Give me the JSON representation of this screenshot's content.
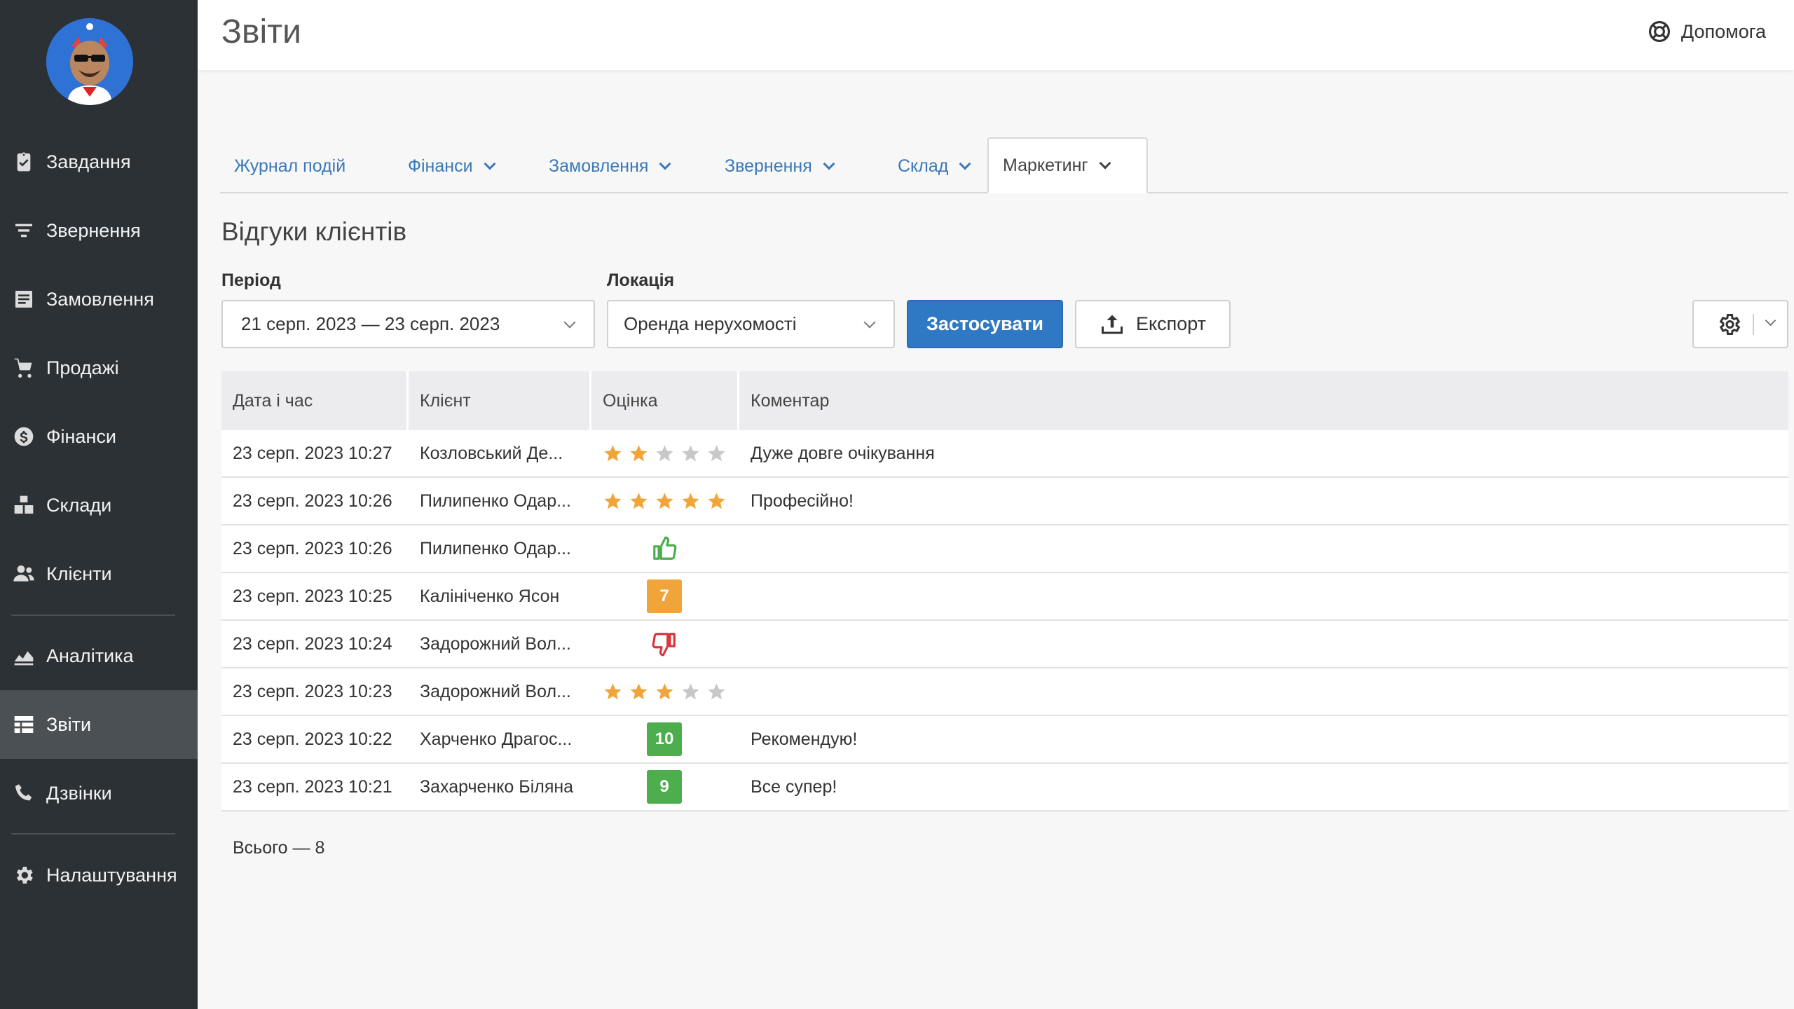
{
  "sidebar": {
    "items": [
      {
        "label": "Завдання",
        "icon": "clipboard-icon"
      },
      {
        "label": "Звернення",
        "icon": "filter-icon"
      },
      {
        "label": "Замовлення",
        "icon": "order-list-icon"
      },
      {
        "label": "Продажі",
        "icon": "cart-icon"
      },
      {
        "label": "Фінанси",
        "icon": "dollar-circle-icon"
      },
      {
        "label": "Склади",
        "icon": "boxes-icon"
      },
      {
        "label": "Клієнти",
        "icon": "users-icon"
      },
      {
        "label": "Аналітика",
        "icon": "area-chart-icon"
      },
      {
        "label": "Звіти",
        "icon": "table-icon",
        "active": true
      },
      {
        "label": "Дзвінки",
        "icon": "phone-icon"
      },
      {
        "label": "Налаштування",
        "icon": "gear-icon"
      }
    ]
  },
  "header": {
    "title": "Звіти",
    "help_label": "Допомога"
  },
  "tabs": [
    {
      "label": "Журнал подій",
      "dropdown": false
    },
    {
      "label": "Фінанси",
      "dropdown": true
    },
    {
      "label": "Замовлення",
      "dropdown": true
    },
    {
      "label": "Звернення",
      "dropdown": true
    },
    {
      "label": "Склад",
      "dropdown": true
    },
    {
      "label": "Маркетинг",
      "dropdown": true,
      "active": true
    }
  ],
  "report": {
    "title": "Відгуки клієнтів",
    "period_label": "Період",
    "period_value": "21 серп. 2023 — 23 серп. 2023",
    "location_label": "Локація",
    "location_value": "Оренда нерухомості",
    "apply_label": "Застосувати",
    "export_label": "Експорт"
  },
  "table": {
    "columns": [
      "Дата і час",
      "Клієнт",
      "Оцінка",
      "Коментар"
    ],
    "rows": [
      {
        "datetime": "23 серп. 2023 10:27",
        "client": "Козловський Де...",
        "rating_type": "stars",
        "rating": 2,
        "comment": "Дуже довге очікування"
      },
      {
        "datetime": "23 серп. 2023 10:26",
        "client": "Пилипенко Одар...",
        "rating_type": "stars",
        "rating": 5,
        "comment": "Професійно!"
      },
      {
        "datetime": "23 серп. 2023 10:26",
        "client": "Пилипенко Одар...",
        "rating_type": "thumb-up",
        "rating": "",
        "comment": ""
      },
      {
        "datetime": "23 серп. 2023 10:25",
        "client": "Калініченко Ясон",
        "rating_type": "score",
        "rating": "7",
        "comment": ""
      },
      {
        "datetime": "23 серп. 2023 10:24",
        "client": "Задорожний Вол...",
        "rating_type": "thumb-down",
        "rating": "",
        "comment": ""
      },
      {
        "datetime": "23 серп. 2023 10:23",
        "client": "Задорожний Вол...",
        "rating_type": "stars",
        "rating": 3,
        "comment": ""
      },
      {
        "datetime": "23 серп. 2023 10:22",
        "client": "Харченко Драгос...",
        "rating_type": "score",
        "rating": "10",
        "comment": "Рекомендую!"
      },
      {
        "datetime": "23 серп. 2023 10:21",
        "client": "Захарченко Біляна",
        "rating_type": "score",
        "rating": "9",
        "comment": "Все супер!"
      }
    ],
    "total_label": "Всього — 8"
  },
  "colors": {
    "sidebar_bg": "#2c3135",
    "sidebar_active": "#4b5054",
    "primary": "#2f78c4",
    "link": "#3a78b8",
    "star_on": "#f0a53a",
    "star_off": "#c8c8c8",
    "score_orange": "#f0a53a",
    "score_green": "#4cae4c",
    "thumb_up": "#4cae4c",
    "thumb_down": "#d9363e"
  }
}
